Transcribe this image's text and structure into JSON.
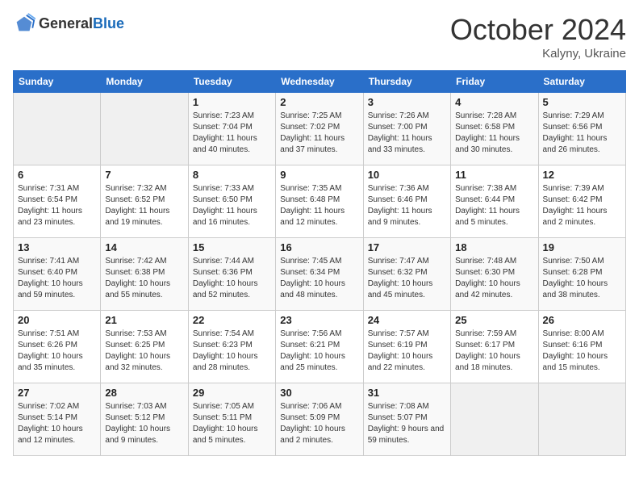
{
  "logo": {
    "general": "General",
    "blue": "Blue"
  },
  "header": {
    "month": "October 2024",
    "location": "Kalyny, Ukraine"
  },
  "weekdays": [
    "Sunday",
    "Monday",
    "Tuesday",
    "Wednesday",
    "Thursday",
    "Friday",
    "Saturday"
  ],
  "weeks": [
    [
      {
        "day": "",
        "sunrise": "",
        "sunset": "",
        "daylight": ""
      },
      {
        "day": "",
        "sunrise": "",
        "sunset": "",
        "daylight": ""
      },
      {
        "day": "1",
        "sunrise": "Sunrise: 7:23 AM",
        "sunset": "Sunset: 7:04 PM",
        "daylight": "Daylight: 11 hours and 40 minutes."
      },
      {
        "day": "2",
        "sunrise": "Sunrise: 7:25 AM",
        "sunset": "Sunset: 7:02 PM",
        "daylight": "Daylight: 11 hours and 37 minutes."
      },
      {
        "day": "3",
        "sunrise": "Sunrise: 7:26 AM",
        "sunset": "Sunset: 7:00 PM",
        "daylight": "Daylight: 11 hours and 33 minutes."
      },
      {
        "day": "4",
        "sunrise": "Sunrise: 7:28 AM",
        "sunset": "Sunset: 6:58 PM",
        "daylight": "Daylight: 11 hours and 30 minutes."
      },
      {
        "day": "5",
        "sunrise": "Sunrise: 7:29 AM",
        "sunset": "Sunset: 6:56 PM",
        "daylight": "Daylight: 11 hours and 26 minutes."
      }
    ],
    [
      {
        "day": "6",
        "sunrise": "Sunrise: 7:31 AM",
        "sunset": "Sunset: 6:54 PM",
        "daylight": "Daylight: 11 hours and 23 minutes."
      },
      {
        "day": "7",
        "sunrise": "Sunrise: 7:32 AM",
        "sunset": "Sunset: 6:52 PM",
        "daylight": "Daylight: 11 hours and 19 minutes."
      },
      {
        "day": "8",
        "sunrise": "Sunrise: 7:33 AM",
        "sunset": "Sunset: 6:50 PM",
        "daylight": "Daylight: 11 hours and 16 minutes."
      },
      {
        "day": "9",
        "sunrise": "Sunrise: 7:35 AM",
        "sunset": "Sunset: 6:48 PM",
        "daylight": "Daylight: 11 hours and 12 minutes."
      },
      {
        "day": "10",
        "sunrise": "Sunrise: 7:36 AM",
        "sunset": "Sunset: 6:46 PM",
        "daylight": "Daylight: 11 hours and 9 minutes."
      },
      {
        "day": "11",
        "sunrise": "Sunrise: 7:38 AM",
        "sunset": "Sunset: 6:44 PM",
        "daylight": "Daylight: 11 hours and 5 minutes."
      },
      {
        "day": "12",
        "sunrise": "Sunrise: 7:39 AM",
        "sunset": "Sunset: 6:42 PM",
        "daylight": "Daylight: 11 hours and 2 minutes."
      }
    ],
    [
      {
        "day": "13",
        "sunrise": "Sunrise: 7:41 AM",
        "sunset": "Sunset: 6:40 PM",
        "daylight": "Daylight: 10 hours and 59 minutes."
      },
      {
        "day": "14",
        "sunrise": "Sunrise: 7:42 AM",
        "sunset": "Sunset: 6:38 PM",
        "daylight": "Daylight: 10 hours and 55 minutes."
      },
      {
        "day": "15",
        "sunrise": "Sunrise: 7:44 AM",
        "sunset": "Sunset: 6:36 PM",
        "daylight": "Daylight: 10 hours and 52 minutes."
      },
      {
        "day": "16",
        "sunrise": "Sunrise: 7:45 AM",
        "sunset": "Sunset: 6:34 PM",
        "daylight": "Daylight: 10 hours and 48 minutes."
      },
      {
        "day": "17",
        "sunrise": "Sunrise: 7:47 AM",
        "sunset": "Sunset: 6:32 PM",
        "daylight": "Daylight: 10 hours and 45 minutes."
      },
      {
        "day": "18",
        "sunrise": "Sunrise: 7:48 AM",
        "sunset": "Sunset: 6:30 PM",
        "daylight": "Daylight: 10 hours and 42 minutes."
      },
      {
        "day": "19",
        "sunrise": "Sunrise: 7:50 AM",
        "sunset": "Sunset: 6:28 PM",
        "daylight": "Daylight: 10 hours and 38 minutes."
      }
    ],
    [
      {
        "day": "20",
        "sunrise": "Sunrise: 7:51 AM",
        "sunset": "Sunset: 6:26 PM",
        "daylight": "Daylight: 10 hours and 35 minutes."
      },
      {
        "day": "21",
        "sunrise": "Sunrise: 7:53 AM",
        "sunset": "Sunset: 6:25 PM",
        "daylight": "Daylight: 10 hours and 32 minutes."
      },
      {
        "day": "22",
        "sunrise": "Sunrise: 7:54 AM",
        "sunset": "Sunset: 6:23 PM",
        "daylight": "Daylight: 10 hours and 28 minutes."
      },
      {
        "day": "23",
        "sunrise": "Sunrise: 7:56 AM",
        "sunset": "Sunset: 6:21 PM",
        "daylight": "Daylight: 10 hours and 25 minutes."
      },
      {
        "day": "24",
        "sunrise": "Sunrise: 7:57 AM",
        "sunset": "Sunset: 6:19 PM",
        "daylight": "Daylight: 10 hours and 22 minutes."
      },
      {
        "day": "25",
        "sunrise": "Sunrise: 7:59 AM",
        "sunset": "Sunset: 6:17 PM",
        "daylight": "Daylight: 10 hours and 18 minutes."
      },
      {
        "day": "26",
        "sunrise": "Sunrise: 8:00 AM",
        "sunset": "Sunset: 6:16 PM",
        "daylight": "Daylight: 10 hours and 15 minutes."
      }
    ],
    [
      {
        "day": "27",
        "sunrise": "Sunrise: 7:02 AM",
        "sunset": "Sunset: 5:14 PM",
        "daylight": "Daylight: 10 hours and 12 minutes."
      },
      {
        "day": "28",
        "sunrise": "Sunrise: 7:03 AM",
        "sunset": "Sunset: 5:12 PM",
        "daylight": "Daylight: 10 hours and 9 minutes."
      },
      {
        "day": "29",
        "sunrise": "Sunrise: 7:05 AM",
        "sunset": "Sunset: 5:11 PM",
        "daylight": "Daylight: 10 hours and 5 minutes."
      },
      {
        "day": "30",
        "sunrise": "Sunrise: 7:06 AM",
        "sunset": "Sunset: 5:09 PM",
        "daylight": "Daylight: 10 hours and 2 minutes."
      },
      {
        "day": "31",
        "sunrise": "Sunrise: 7:08 AM",
        "sunset": "Sunset: 5:07 PM",
        "daylight": "Daylight: 9 hours and 59 minutes."
      },
      {
        "day": "",
        "sunrise": "",
        "sunset": "",
        "daylight": ""
      },
      {
        "day": "",
        "sunrise": "",
        "sunset": "",
        "daylight": ""
      }
    ]
  ]
}
